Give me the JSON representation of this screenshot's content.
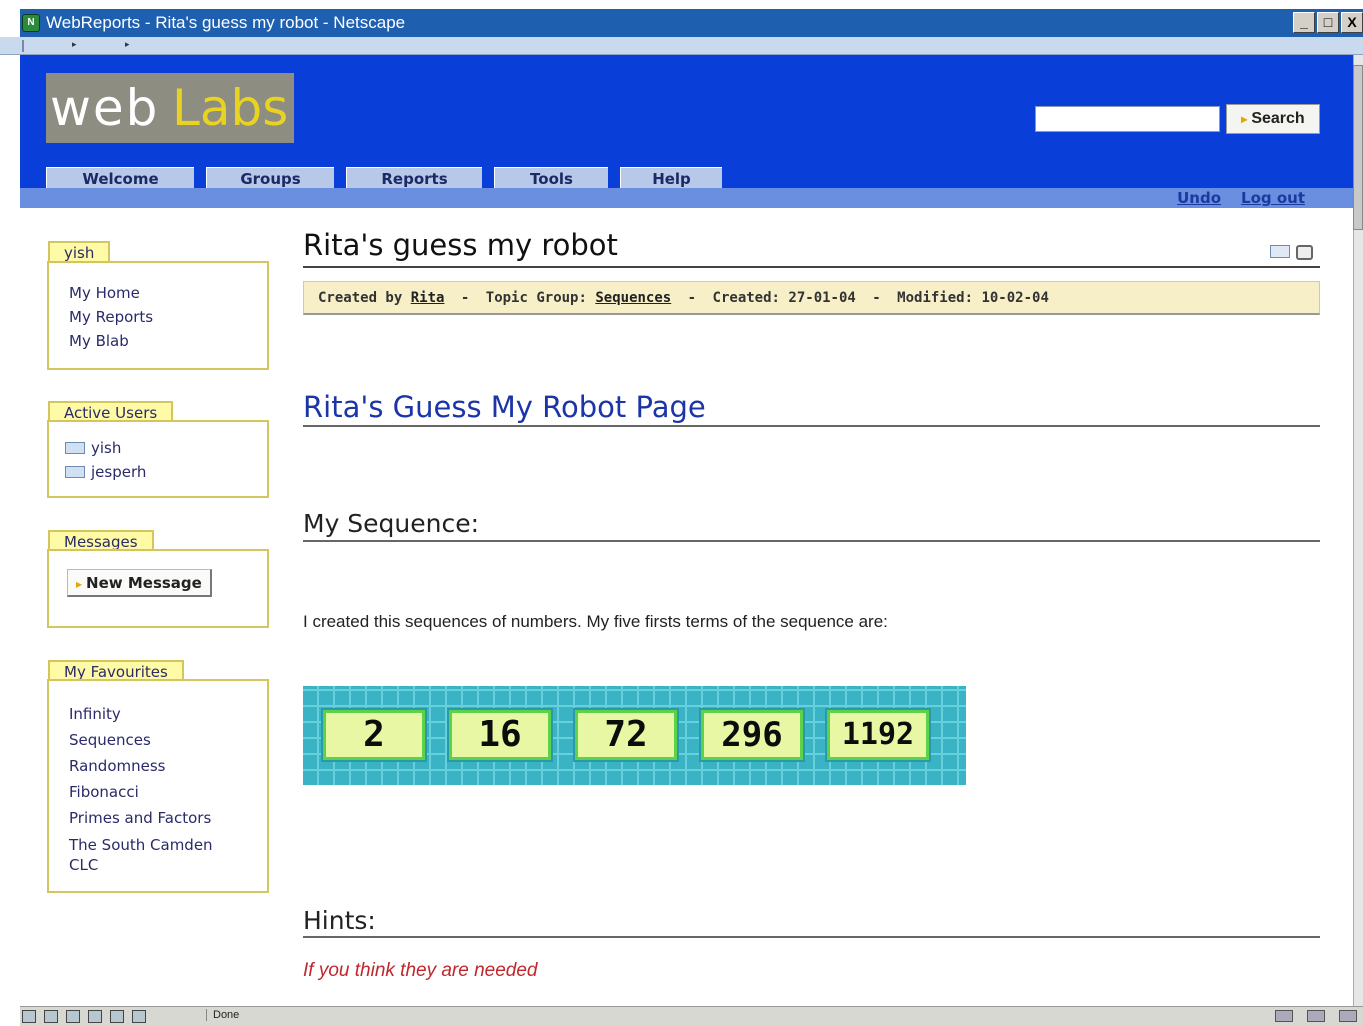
{
  "window": {
    "title": "WebReports - Rita's guess my robot - Netscape",
    "buttons": [
      "_",
      "□",
      "X"
    ]
  },
  "header": {
    "logo_web": "web",
    "logo_labs": "Labs",
    "search_placeholder": "",
    "search_label": "Search",
    "nav_tabs": [
      "Welcome",
      "Groups",
      "Reports",
      "Tools",
      "Help"
    ],
    "sub_links": [
      "Undo",
      "Log out"
    ]
  },
  "sidebar": {
    "user_box": {
      "tab": "yish",
      "items": [
        "My Home",
        "My Reports",
        "My Blab"
      ]
    },
    "active_users": {
      "tab": "Active Users",
      "users": [
        "yish",
        "jesperh"
      ]
    },
    "messages": {
      "tab": "Messages",
      "new_message": "New Message"
    },
    "favourites": {
      "tab": "My Favourites",
      "items": [
        "Infinity",
        "Sequences",
        "Randomness",
        "Fibonacci",
        "Primes and Factors",
        "The South Camden CLC"
      ]
    }
  },
  "main": {
    "title": "Rita's guess my robot",
    "meta": {
      "created_by_label": "Created by",
      "author": "Rita",
      "topic_label": "Topic Group:",
      "topic": "Sequences",
      "created_label": "Created:",
      "created": "27-01-04",
      "modified_label": "Modified:",
      "modified": "10-02-04",
      "separator": "-"
    },
    "page_heading": "Rita's Guess My Robot Page",
    "sequence_heading": "My Sequence:",
    "sequence_text": "I created this sequences of numbers. My five firsts terms of the sequence are:",
    "sequence_values": [
      "2",
      "16",
      "72",
      "296",
      "1192"
    ],
    "hints_heading": "Hints:",
    "hint_text": "If you think they are needed"
  },
  "statusbar": {
    "text": "Done"
  },
  "colors": {
    "header_blue": "#0a3ed9",
    "sidebar_border": "#d4c55c",
    "link_heading": "#1b35a8",
    "hint_red": "#c0262b"
  }
}
